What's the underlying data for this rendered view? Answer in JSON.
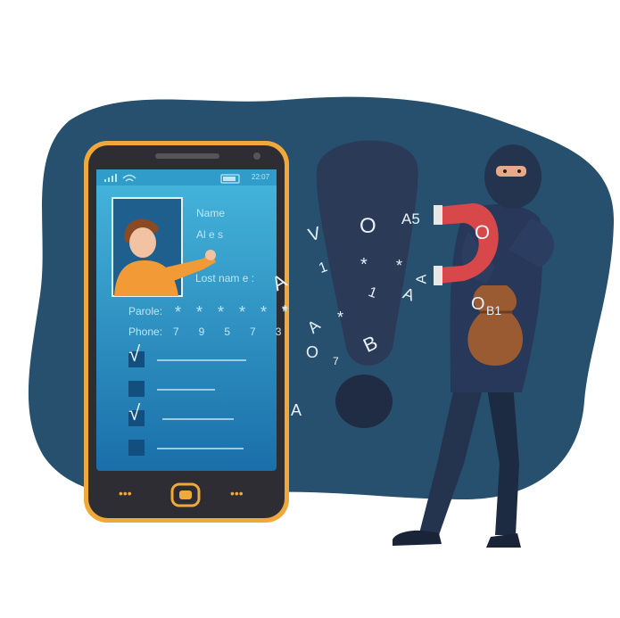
{
  "phone": {
    "status_time": "22:07",
    "labels": {
      "name": "Name",
      "alias": "Al e    s",
      "last_name": "Lost nam e :",
      "parole": "Parole:",
      "parole_value": "* * * * * *",
      "phone": "Phone:",
      "phone_value": "7   9   5   7   3"
    },
    "checklist": [
      {
        "checked": true,
        "mark": "√"
      },
      {
        "checked": false,
        "mark": ""
      },
      {
        "checked": true,
        "mark": "√"
      },
      {
        "checked": false,
        "mark": ""
      }
    ],
    "nav_left": "•••",
    "nav_right": "•••"
  },
  "floating_chars": [
    "V",
    "O",
    "A5",
    "1",
    "*",
    "*",
    "A",
    "*",
    "1",
    "A",
    "*",
    "A",
    "O",
    "B",
    "A",
    "O",
    "7",
    "O",
    "B1",
    "A"
  ],
  "colors": {
    "blob": "#27506f",
    "exclamation": "#2b3b57",
    "phone_frame": "#f1a83a",
    "phone_body": "#2d2d33",
    "screen_top": "#3aa9d4",
    "screen_bottom": "#1b78b4",
    "thief_suit": "#24344f",
    "magnet": "#d8474a",
    "bag": "#9a5b32"
  }
}
